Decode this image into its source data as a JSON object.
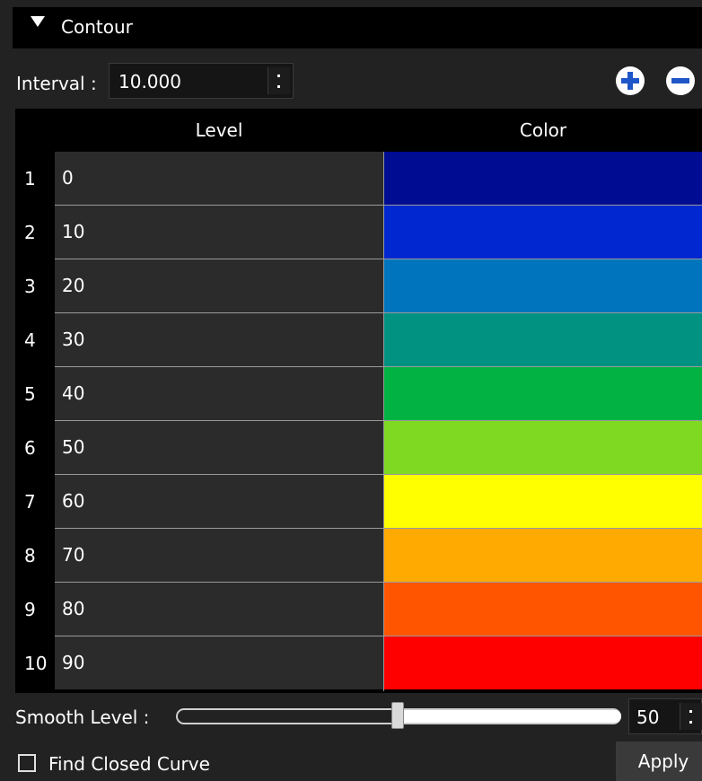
{
  "panel": {
    "title": "Contour"
  },
  "interval": {
    "label": "Interval :",
    "value": "10.000"
  },
  "table": {
    "headers": {
      "level": "Level",
      "color": "Color"
    },
    "rows": [
      {
        "index": "1",
        "level": "0",
        "color": "#000c91"
      },
      {
        "index": "2",
        "level": "10",
        "color": "#0027d0"
      },
      {
        "index": "3",
        "level": "20",
        "color": "#0075bd"
      },
      {
        "index": "4",
        "level": "30",
        "color": "#029282"
      },
      {
        "index": "5",
        "level": "40",
        "color": "#02b344"
      },
      {
        "index": "6",
        "level": "50",
        "color": "#7fd922"
      },
      {
        "index": "7",
        "level": "60",
        "color": "#ffff00"
      },
      {
        "index": "8",
        "level": "70",
        "color": "#ffaa00"
      },
      {
        "index": "9",
        "level": "80",
        "color": "#ff5500"
      },
      {
        "index": "10",
        "level": "90",
        "color": "#ff0000"
      }
    ]
  },
  "smooth": {
    "label": "Smooth Level :",
    "value": "50",
    "slider_fraction": 0.5
  },
  "find_closed_curve": {
    "label": "Find Closed Curve",
    "checked": false
  },
  "apply": {
    "label": "Apply"
  },
  "icons": {
    "collapse": "triangle-down-icon",
    "add": "plus-circle-icon",
    "remove": "minus-circle-icon"
  }
}
